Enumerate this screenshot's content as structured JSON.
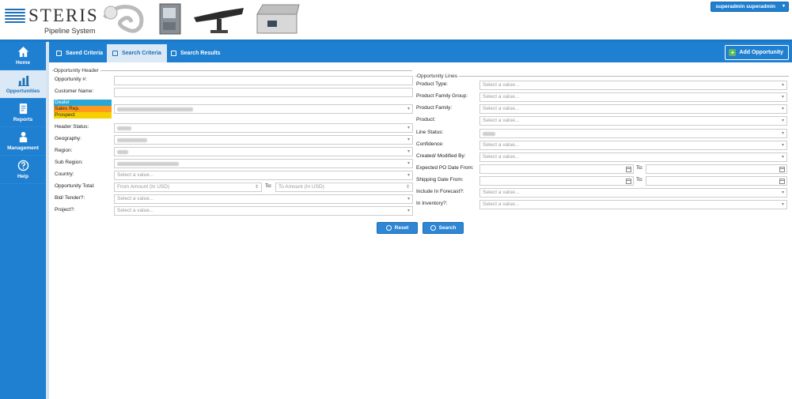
{
  "brand": {
    "name": "STERIS",
    "subtitle": "Pipeline System"
  },
  "user": {
    "label": "superadmin superadmin"
  },
  "sidebar": {
    "items": [
      {
        "label": "Home",
        "icon": "home-icon"
      },
      {
        "label": "Opportunities",
        "icon": "chart-icon",
        "active": true
      },
      {
        "label": "Reports",
        "icon": "reports-icon"
      },
      {
        "label": "Management",
        "icon": "person-icon"
      },
      {
        "label": "Help",
        "icon": "help-icon"
      }
    ]
  },
  "tabs": [
    {
      "label": "Saved Criteria"
    },
    {
      "label": "Search Criteria",
      "selected": true
    },
    {
      "label": "Search Results"
    }
  ],
  "add_button": "Add Opportunity",
  "header_section": {
    "legend": "Opportunity Header",
    "opportunity_no": "Opportunity #:",
    "customer_name": "Customer Name:",
    "roles": [
      "Dealer",
      "Sales Rep.",
      "Prospect"
    ],
    "header_status": "Header Status:",
    "geography": "Geography:",
    "region": "Region:",
    "sub_region": "Sub Region:",
    "country": "Country:",
    "opportunity_total": "Opportunity Total:",
    "bid_tender": "Bid/ Tender?:",
    "project": "Project?:",
    "to": "To:",
    "from_amount_placeholder": "From Amount (In USD)",
    "to_amount_placeholder": "To Amount (In USD)",
    "select_placeholder": "Select a value..."
  },
  "lines_section": {
    "legend": "Opportunity Lines",
    "product_type": "Product Type:",
    "product_family_group": "Product Family Group:",
    "product_family": "Product Family:",
    "product": "Product:",
    "line_status": "Line Status:",
    "confidence": "Confidence:",
    "created_modified_by": "Created/ Modified By:",
    "expected_po_date_from": "Expected PO Date From:",
    "shipping_date_from": "Shipping Date From:",
    "include_in_forecast": "Include In Forecast?:",
    "in_inventory": "In Inventory?:",
    "to": "To:",
    "select_placeholder": "Select a value..."
  },
  "actions": {
    "reset": "Reset",
    "search": "Search"
  },
  "colors": {
    "primary": "#1f7fd0",
    "dealer": "#2aa7d6",
    "sales_rep": "#ff9a1f",
    "prospect": "#f5d100",
    "add_icon": "#5cb85c"
  }
}
